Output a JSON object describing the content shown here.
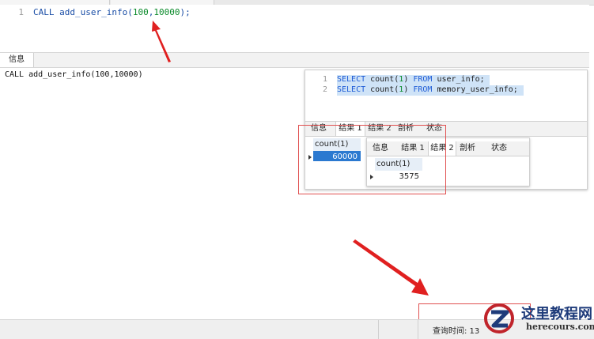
{
  "editor": {
    "line_number": "1",
    "code_parts": [
      "CALL add_user_info(",
      "100",
      ",",
      "10000",
      ");"
    ]
  },
  "bottom_panel": {
    "tab_label": "信息",
    "output_text": "CALL add_user_info(100,10000)"
  },
  "overlay_query": {
    "line1_number": "1",
    "line2_number": "2",
    "line1_parts": [
      "SELECT",
      " count(",
      "1",
      ") ",
      "FROM",
      " user_info;"
    ],
    "line2_parts": [
      "SELECT",
      " count(",
      "1",
      ") ",
      "FROM",
      " memory_user_info;"
    ],
    "tabs": [
      "信息",
      "结果 1",
      "结果 2",
      "剖析",
      "状态"
    ],
    "column_header": "count(1)",
    "cell_value": "60000"
  },
  "overlay_result2": {
    "tabs": [
      "信息",
      "结果 1",
      "结果 2",
      "剖析",
      "状态"
    ],
    "column_header": "count(1)",
    "cell_value": "3575"
  },
  "status_bar": {
    "query_time_label": "查询时间: 13"
  },
  "watermark": {
    "site_name": "这里教程网",
    "url": "herecours.com"
  },
  "colors": {
    "keyword_blue": "#1d5bd6",
    "number_green": "#0a8a2a",
    "selection_blue": "#2b79d0",
    "highlight_red": "#e05050",
    "arrow_red": "#e02020"
  }
}
